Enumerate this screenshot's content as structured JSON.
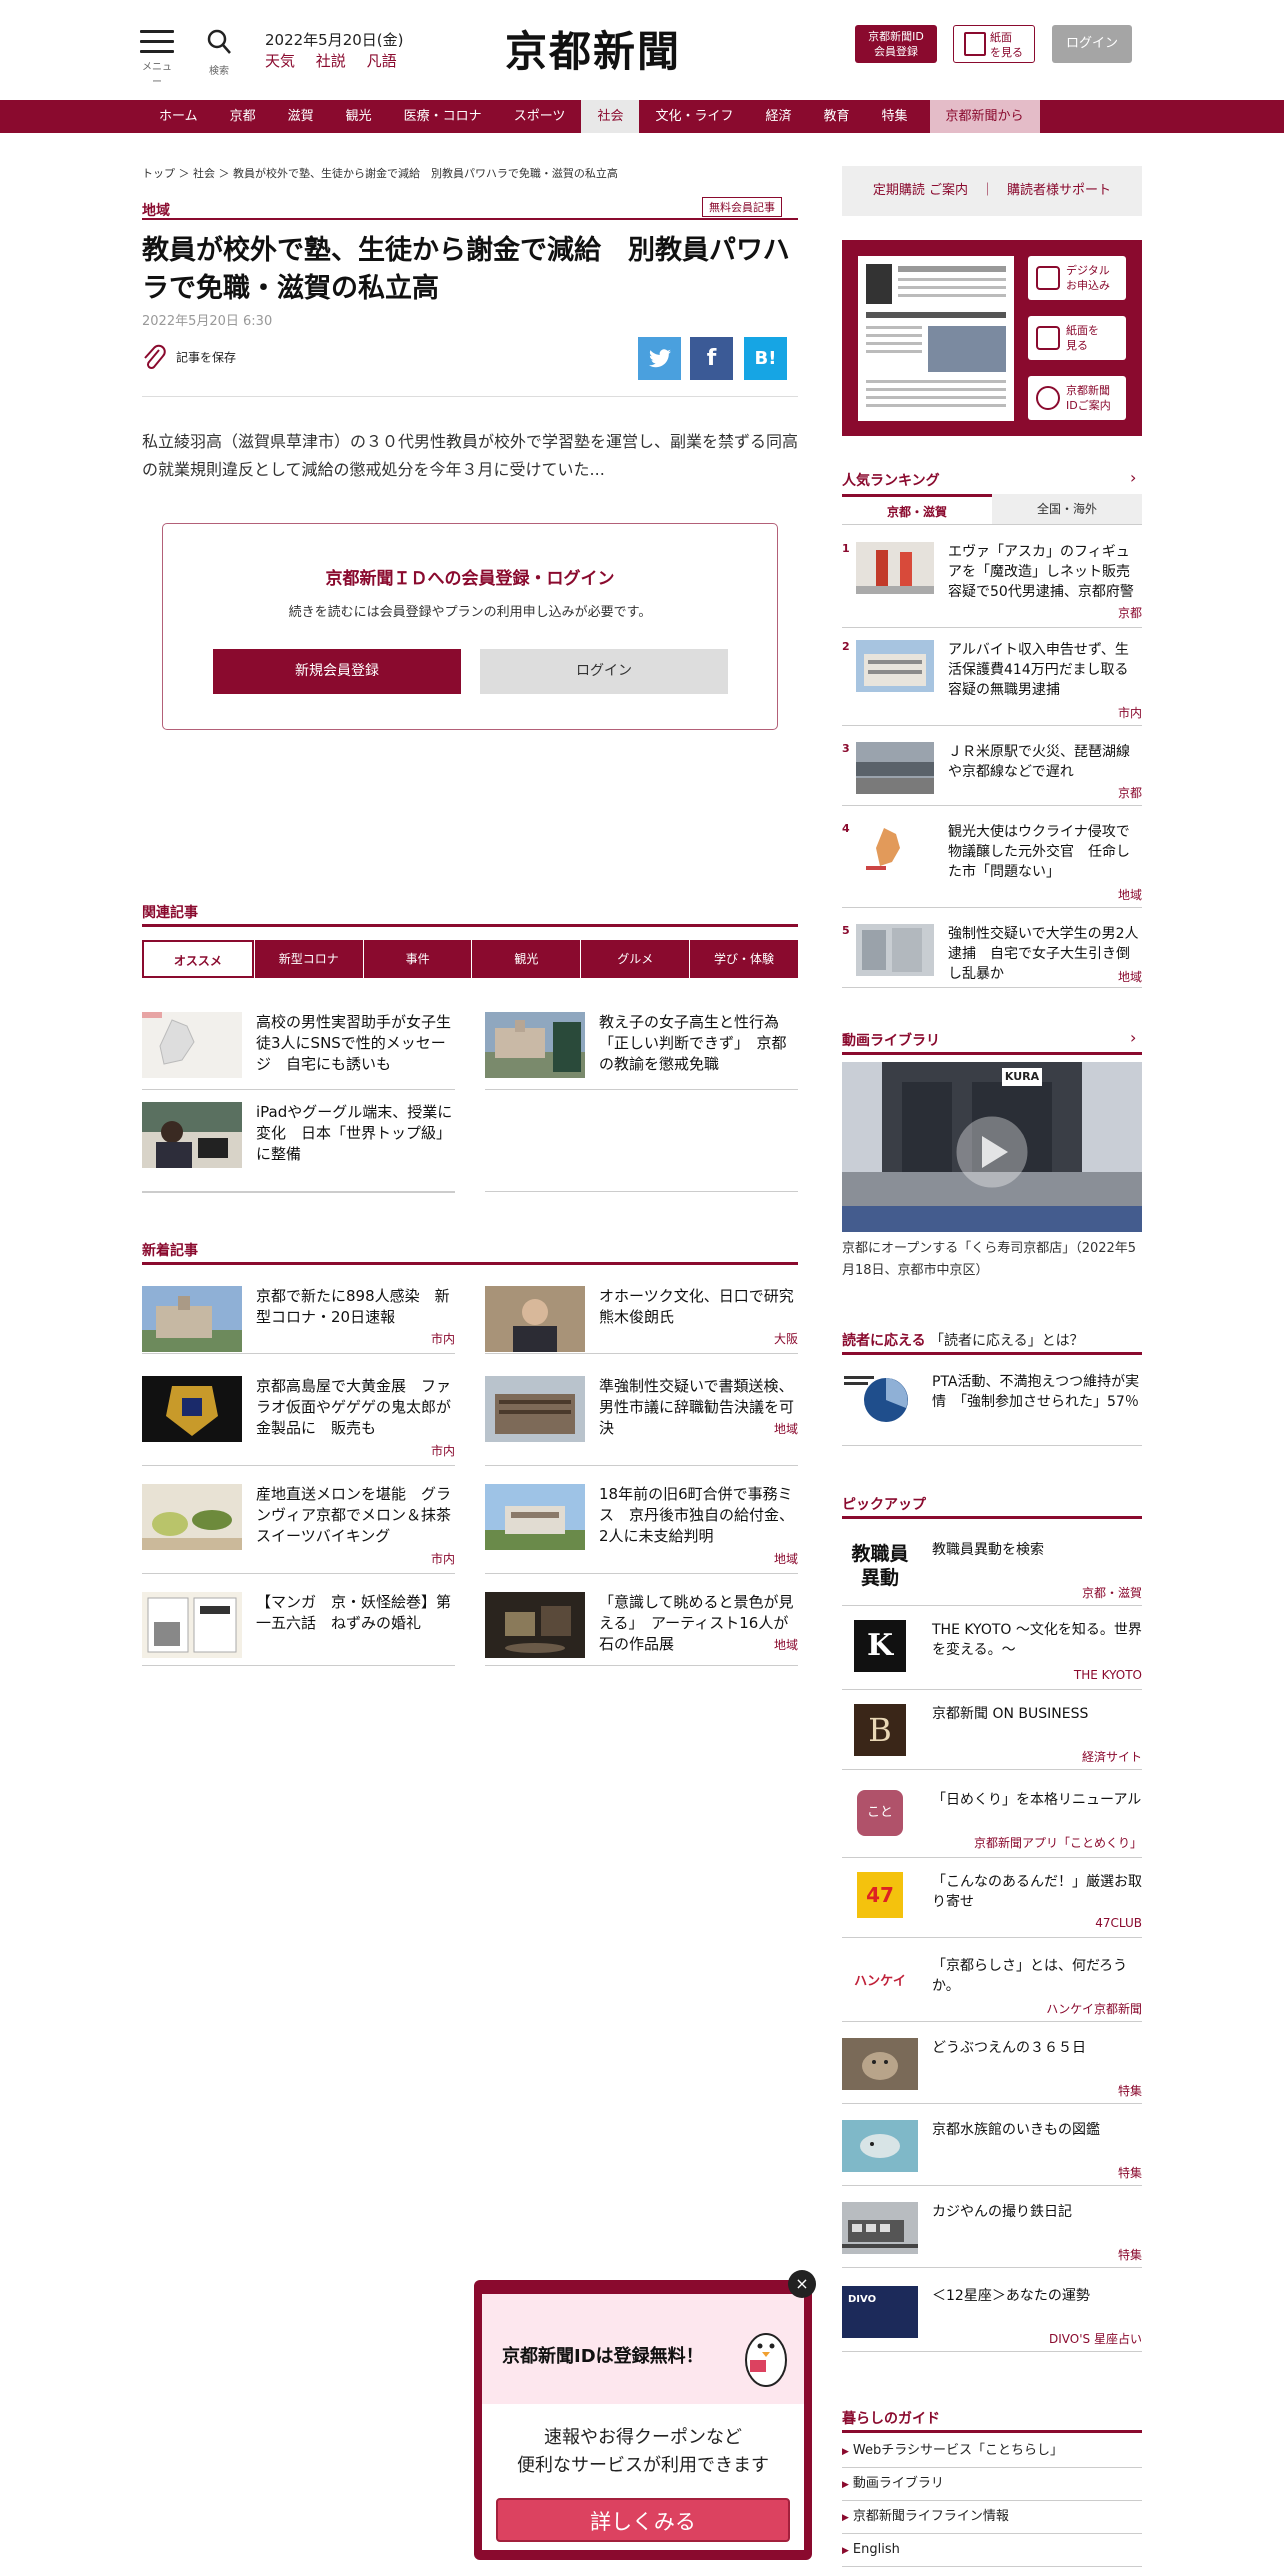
{
  "header": {
    "menu_label": "メニュー",
    "search_label": "検索",
    "date": "2022年5月20日(金)",
    "links": [
      "天気",
      "社説",
      "凡語"
    ],
    "logo": "京都新聞",
    "id_register": [
      "京都新聞ID",
      "会員登録"
    ],
    "paper_view": [
      "紙面",
      "を見る"
    ],
    "login": "ログイン"
  },
  "nav": {
    "items": [
      "ホーム",
      "京都",
      "滋賀",
      "観光",
      "医療・コロナ",
      "スポーツ",
      "社会",
      "文化・ライフ",
      "経済",
      "教育",
      "特集"
    ],
    "active": "社会",
    "special": "京都新聞から"
  },
  "article": {
    "breadcrumb": "トップ ＞ 社会 ＞ 教員が校外で塾、生徒から謝金で減給　別教員パワハラで免職・滋賀の私立高",
    "category": "地域",
    "badge": "無料会員記事",
    "headline": "教員が校外で塾、生徒から謝金で減給　別教員パワハラで免職・滋賀の私立高",
    "date": "2022年5月20日 6:30",
    "save_label": "記事を保存",
    "share": {
      "twitter": "🐦",
      "facebook": "f",
      "hatena": "B!"
    },
    "lead": "私立綾羽高（滋賀県草津市）の３０代男性教員が校外で学習塾を運営し、副業を禁ずる同高の就業規則違反として減給の懲戒処分を今年３月に受けていた..."
  },
  "login_box": {
    "title": "京都新聞ＩＤへの会員登録・ログイン",
    "subtitle": "続きを読むには会員登録やプランの利用申し込みが必要です。",
    "register": "新規会員登録",
    "login": "ログイン"
  },
  "related": {
    "title": "関連記事",
    "tabs": [
      "オススメ",
      "新型コロナ",
      "事件",
      "観光",
      "グルメ",
      "学び・体験"
    ],
    "items": [
      {
        "title": "高校の男性実習助手が女子生徒3人にSNSで性的メッセージ　自宅にも誘いも"
      },
      {
        "title": "教え子の女子高生と性行為「正しい判断できず」　京都の教諭を懲戒免職"
      },
      {
        "title": "iPadやグーグル端末、授業に変化　日本「世界トップ級」に整備"
      }
    ]
  },
  "latest": {
    "title": "新着記事",
    "items": [
      {
        "title": "京都で新たに898人感染　新型コロナ・20日速報",
        "tag": "市内"
      },
      {
        "title": "オホーツク文化、日口で研究　熊木俊朗氏",
        "tag": "大阪"
      },
      {
        "title": "京都高島屋で大黄金展　ファラオ仮面やゲゲゲの鬼太郎が金製品に　販売も",
        "tag": "市内"
      },
      {
        "title": "準強制性交疑いで書類送検、男性市議に辞職勧告決議を可決",
        "tag": "地域"
      },
      {
        "title": "産地直送メロンを堪能　グランヴィア京都でメロン＆抹茶スイーツバイキング",
        "tag": "市内"
      },
      {
        "title": "18年前の旧6町合併で事務ミス　京丹後市独自の給付金、2人に未支給判明",
        "tag": "地域"
      },
      {
        "title": "【マンガ　京・妖怪絵巻】第一五六話　ねずみの婚礼",
        "tag": ""
      },
      {
        "title": "「意識して眺めると景色が見える」　アーティスト16人が石の作品展",
        "tag": "地域"
      }
    ]
  },
  "sidebar": {
    "subscription": "定期購読 ご案内　｜　購読者様サポート",
    "paper_buttons": [
      [
        "デジタル",
        "お申込み"
      ],
      [
        "紙面を",
        "見る"
      ],
      [
        "京都新聞",
        "IDご案内"
      ]
    ],
    "ranking": {
      "title": "人気ランキング",
      "arrow": "›",
      "tab_active": "京都・滋賀",
      "tab_other": "全国・海外",
      "items": [
        {
          "num": "1",
          "title": "エヴァ「アスカ」のフィギュアを「魔改造」しネット販売　容疑で50代男逮捕、京都府警",
          "tag": "京都"
        },
        {
          "num": "2",
          "title": "アルバイト収入申告せず、生活保護費414万円だまし取る　容疑の無職男逮捕",
          "tag": "市内"
        },
        {
          "num": "3",
          "title": "ＪＲ米原駅で火災、琵琶湖線や京都線などで遅れ",
          "tag": "京都"
        },
        {
          "num": "4",
          "title": "観光大使はウクライナ侵攻で物議醸した元外交官　任命した市「問題ない」",
          "tag": "地域"
        },
        {
          "num": "5",
          "title": "強制性交疑いで大学生の男2人逮捕　自宅で女子大生引き倒し乱暴か",
          "tag": "地域"
        }
      ]
    },
    "video": {
      "title": "動画ライブラリ",
      "arrow": "›",
      "caption": "京都にオープンする「くら寿司京都店」（2022年5月18日、京都市中京区）",
      "sign": "KURA"
    },
    "answer": {
      "label": "読者に応える",
      "question": "「読者に応える」とは？",
      "item": "PTA活動、不満抱えつつ維持が実情　「強制参加させられた」57％"
    },
    "pickup": {
      "title": "ピックアップ",
      "items": [
        {
          "title": "教職員異動を検索",
          "tag": "京都・滋賀",
          "icon_text": "教職員\n異動"
        },
        {
          "title": "THE KYOTO ～文化を知る。世界を変える。～",
          "tag": "THE KYOTO",
          "icon_text": "K"
        },
        {
          "title": "京都新聞 ON BUSINESS",
          "tag": "経済サイト",
          "icon_text": "B"
        },
        {
          "title": "「日めくり」を本格リニューアル",
          "tag": "京都新聞アプリ「ことめくり」",
          "icon_text": "こと"
        },
        {
          "title": "「こんなのあるんだ！」厳選お取り寄せ",
          "tag": "47CLUB",
          "icon_text": "47"
        },
        {
          "title": "「京都らしさ」とは、何だろうか。",
          "tag": "ハンケイ京都新聞",
          "icon_text": "ハンケイ"
        },
        {
          "title": "どうぶつえんの３６５日",
          "tag": "特集",
          "icon_text": ""
        },
        {
          "title": "京都水族館のいきもの図鑑",
          "tag": "特集",
          "icon_text": ""
        },
        {
          "title": "カジやんの撮り鉄日記",
          "tag": "特集",
          "icon_text": ""
        },
        {
          "title": "＜12星座＞あなたの運勢",
          "tag": "DIVO'S 星座占い",
          "icon_text": "DIVO"
        }
      ]
    },
    "guide": {
      "title": "暮らしのガイド",
      "items": [
        "Webチラシサービス「ことちらし」",
        "動画ライブラリ",
        "京都新聞ライフライン情報",
        "English"
      ]
    }
  },
  "popup": {
    "title": "京都新聞IDは登録無料！",
    "body_lines": [
      "速報やお得クーポンなど",
      "便利なサービスが利用できます"
    ],
    "button": "詳しくみる",
    "close": "×"
  },
  "colors": {
    "brand": "#8a0a2e",
    "accent": "#dc4260"
  }
}
